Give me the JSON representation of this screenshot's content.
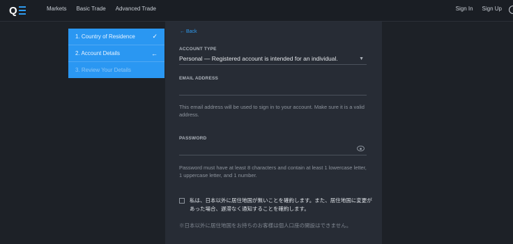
{
  "header": {
    "logo_text": "Q",
    "nav": [
      "Markets",
      "Basic Trade",
      "Advanced Trade"
    ],
    "sign_in": "Sign In",
    "sign_up": "Sign Up"
  },
  "steps": [
    {
      "label": "1. Country of Residence",
      "mark": "✓"
    },
    {
      "label": "2. Account Details",
      "mark": "←"
    },
    {
      "label": "3. Review Your Details",
      "mark": ""
    }
  ],
  "form": {
    "back": "← Back",
    "account_type_label": "ACCOUNT TYPE",
    "account_type_value": "Personal — Registered account is intended for an individual.",
    "email_label": "EMAIL ADDRESS",
    "email_help": "This email address will be used to sign in to your account. Make sure it is a valid address.",
    "password_label": "PASSWORD",
    "password_help": "Password must have at least 8 characters and contain at least 1 lowercase letter, 1 uppercase letter, and 1 number.",
    "residency_check": "私は、日本以外に居住地国が無いことを確約します。また、居住地国に変更があった場合、遅滞なく通知することを確約します。",
    "residency_note": "※日本以外に居住地国をお持ちのお客様は個人口座の開設はできません。"
  },
  "colors": {
    "accent": "#2a97f2",
    "background": "#1d2127",
    "panel": "#272c35"
  }
}
